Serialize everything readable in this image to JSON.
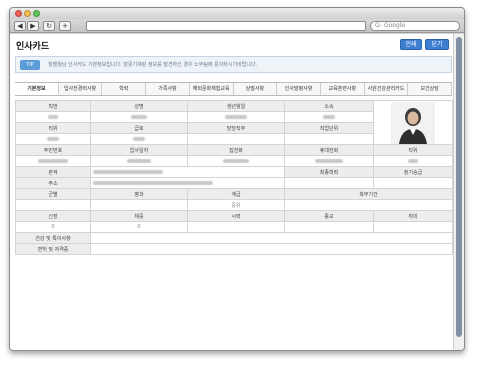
{
  "browser": {
    "search_placeholder": "Q- Google",
    "nav_back": "◀",
    "nav_forward": "▶",
    "reload": "↻",
    "add": "+"
  },
  "page": {
    "title": "인사카드",
    "print_button": "인쇄",
    "close_button": "닫기",
    "tip_badge": "TIP",
    "tip_text": "월별월님 인사카드 기본정보입니다. 잘못기재된 정보를 발견하신 경우 노무팀에 문의하시기바랍니다."
  },
  "tabs": [
    {
      "label": "기본정보",
      "active": true
    },
    {
      "label": "입사전경력사항",
      "active": false
    },
    {
      "label": "학력",
      "active": false
    },
    {
      "label": "가족사항",
      "active": false
    },
    {
      "label": "해외문화체험교육",
      "active": false
    },
    {
      "label": "상벌사항",
      "active": false
    },
    {
      "label": "인사발령사항",
      "active": false
    },
    {
      "label": "교육훈련사항",
      "active": false
    },
    {
      "label": "사원건강관리카드",
      "active": false
    },
    {
      "label": "보건상담",
      "active": false
    }
  ],
  "info": {
    "h_emp_no": "직번",
    "h_name": "성명",
    "h_birth": "생년월일",
    "h_dept": "소속",
    "h_position": "직위",
    "h_grade": "급호",
    "h_duty": "담당직무",
    "h_unit": "직업단위",
    "h_resident_no": "주민번호",
    "h_join_date": "입사일자",
    "h_home_phone": "집전화",
    "h_mobile": "휴대전화",
    "h_origin": "본적",
    "h_education": "최종학력",
    "h_promotion": "정기승급",
    "h_address": "주소",
    "h_military": "군별",
    "h_branch": "병과",
    "h_rank": "계급",
    "h_service": "복무기간",
    "h_height": "신장",
    "h_weight": "체중",
    "h_vision": "시력",
    "h_religion": "종교",
    "h_hobby": "취미",
    "v_rank": "중위",
    "v_height": "0",
    "v_weight": "0",
    "h_health": "건강 및 특이사항",
    "h_license": "면허 및 자격증"
  }
}
